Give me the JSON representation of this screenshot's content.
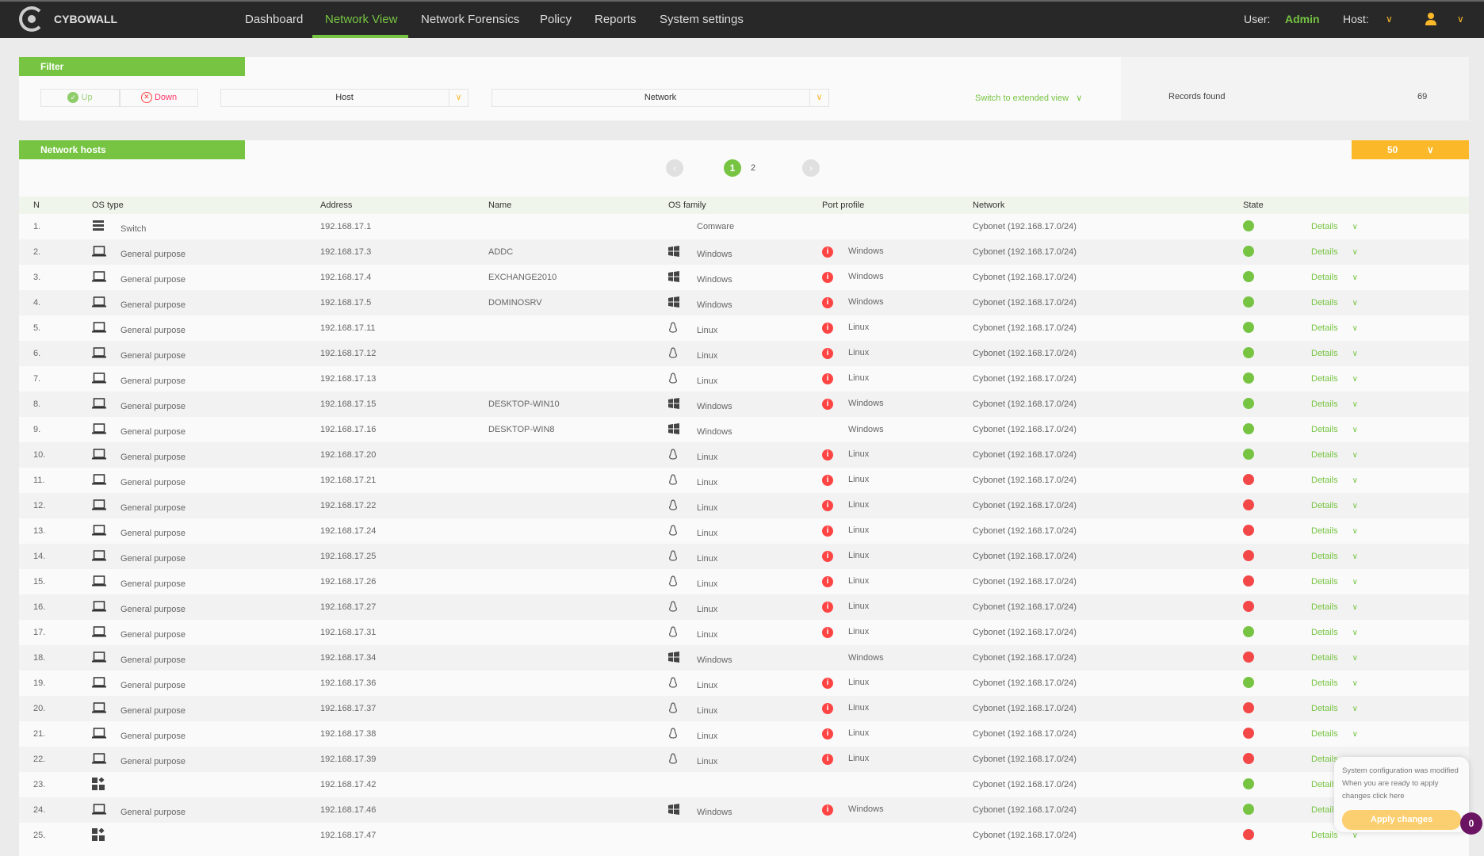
{
  "nav": {
    "brand": "CYBOWALL",
    "items": [
      "Dashboard",
      "Network View",
      "Network Forensics",
      "Policy",
      "Reports",
      "System settings"
    ],
    "active": "Network View",
    "user_label": "User:",
    "user": "Admin",
    "host_label": "Host:"
  },
  "filter": {
    "title": "Filter",
    "up": "Up",
    "down": "Down",
    "host": "Host",
    "network": "Network",
    "extended": "Switch to extended view",
    "records_label": "Records found",
    "records": "69"
  },
  "hosts": {
    "title": "Network hosts",
    "page_size": "50",
    "pages": [
      "1",
      "2"
    ],
    "current_page": "1",
    "columns": [
      "N",
      "OS type",
      "Address",
      "Name",
      "OS family",
      "Port profile",
      "Network",
      "State"
    ],
    "details_label": "Details",
    "rows": [
      [
        "1.",
        "switch",
        "Switch",
        "192.168.17.1",
        "",
        "",
        "Comware",
        "",
        "",
        "Cybonet (192.168.17.0/24)",
        "up"
      ],
      [
        "2.",
        "laptop",
        "General purpose",
        "192.168.17.3",
        "ADDC",
        "windows",
        "Windows",
        "info",
        "Windows",
        "Cybonet (192.168.17.0/24)",
        "up"
      ],
      [
        "3.",
        "laptop",
        "General purpose",
        "192.168.17.4",
        "EXCHANGE2010",
        "windows",
        "Windows",
        "info",
        "Windows",
        "Cybonet (192.168.17.0/24)",
        "up"
      ],
      [
        "4.",
        "laptop",
        "General purpose",
        "192.168.17.5",
        "DOMINOSRV",
        "windows",
        "Windows",
        "info",
        "Windows",
        "Cybonet (192.168.17.0/24)",
        "up"
      ],
      [
        "5.",
        "laptop",
        "General purpose",
        "192.168.17.11",
        "",
        "linux",
        "Linux",
        "info",
        "Linux",
        "Cybonet (192.168.17.0/24)",
        "up"
      ],
      [
        "6.",
        "laptop",
        "General purpose",
        "192.168.17.12",
        "",
        "linux",
        "Linux",
        "info",
        "Linux",
        "Cybonet (192.168.17.0/24)",
        "up"
      ],
      [
        "7.",
        "laptop",
        "General purpose",
        "192.168.17.13",
        "",
        "linux",
        "Linux",
        "info",
        "Linux",
        "Cybonet (192.168.17.0/24)",
        "up"
      ],
      [
        "8.",
        "laptop",
        "General purpose",
        "192.168.17.15",
        "DESKTOP-WIN10",
        "windows",
        "Windows",
        "info",
        "Windows",
        "Cybonet (192.168.17.0/24)",
        "up"
      ],
      [
        "9.",
        "laptop",
        "General purpose",
        "192.168.17.16",
        "DESKTOP-WIN8",
        "windows",
        "Windows",
        "",
        "Windows",
        "Cybonet (192.168.17.0/24)",
        "up"
      ],
      [
        "10.",
        "laptop",
        "General purpose",
        "192.168.17.20",
        "",
        "linux",
        "Linux",
        "info",
        "Linux",
        "Cybonet (192.168.17.0/24)",
        "up"
      ],
      [
        "11.",
        "laptop",
        "General purpose",
        "192.168.17.21",
        "",
        "linux",
        "Linux",
        "info",
        "Linux",
        "Cybonet (192.168.17.0/24)",
        "down"
      ],
      [
        "12.",
        "laptop",
        "General purpose",
        "192.168.17.22",
        "",
        "linux",
        "Linux",
        "info",
        "Linux",
        "Cybonet (192.168.17.0/24)",
        "down"
      ],
      [
        "13.",
        "laptop",
        "General purpose",
        "192.168.17.24",
        "",
        "linux",
        "Linux",
        "info",
        "Linux",
        "Cybonet (192.168.17.0/24)",
        "down"
      ],
      [
        "14.",
        "laptop",
        "General purpose",
        "192.168.17.25",
        "",
        "linux",
        "Linux",
        "info",
        "Linux",
        "Cybonet (192.168.17.0/24)",
        "down"
      ],
      [
        "15.",
        "laptop",
        "General purpose",
        "192.168.17.26",
        "",
        "linux",
        "Linux",
        "info",
        "Linux",
        "Cybonet (192.168.17.0/24)",
        "down"
      ],
      [
        "16.",
        "laptop",
        "General purpose",
        "192.168.17.27",
        "",
        "linux",
        "Linux",
        "info",
        "Linux",
        "Cybonet (192.168.17.0/24)",
        "down"
      ],
      [
        "17.",
        "laptop",
        "General purpose",
        "192.168.17.31",
        "",
        "linux",
        "Linux",
        "info",
        "Linux",
        "Cybonet (192.168.17.0/24)",
        "up"
      ],
      [
        "18.",
        "laptop",
        "General purpose",
        "192.168.17.34",
        "",
        "windows",
        "Windows",
        "",
        "Windows",
        "Cybonet (192.168.17.0/24)",
        "down"
      ],
      [
        "19.",
        "laptop",
        "General purpose",
        "192.168.17.36",
        "",
        "linux",
        "Linux",
        "info",
        "Linux",
        "Cybonet (192.168.17.0/24)",
        "up"
      ],
      [
        "20.",
        "laptop",
        "General purpose",
        "192.168.17.37",
        "",
        "linux",
        "Linux",
        "info",
        "Linux",
        "Cybonet (192.168.17.0/24)",
        "down"
      ],
      [
        "21.",
        "laptop",
        "General purpose",
        "192.168.17.38",
        "",
        "linux",
        "Linux",
        "info",
        "Linux",
        "Cybonet (192.168.17.0/24)",
        "down"
      ],
      [
        "22.",
        "laptop",
        "General purpose",
        "192.168.17.39",
        "",
        "linux",
        "Linux",
        "info",
        "Linux",
        "Cybonet (192.168.17.0/24)",
        "down"
      ],
      [
        "23.",
        "apps",
        "",
        "192.168.17.42",
        "",
        "",
        "",
        "",
        "",
        "Cybonet (192.168.17.0/24)",
        "up"
      ],
      [
        "24.",
        "laptop",
        "General purpose",
        "192.168.17.46",
        "",
        "windows",
        "Windows",
        "info",
        "Windows",
        "Cybonet (192.168.17.0/24)",
        "up"
      ],
      [
        "25.",
        "apps",
        "",
        "192.168.17.47",
        "",
        "",
        "",
        "",
        "",
        "Cybonet (192.168.17.0/24)",
        "down"
      ]
    ]
  },
  "popup": {
    "line1": "System configuration was modified",
    "line2": "When you are ready to apply",
    "line3": "changes click here",
    "button": "Apply changes",
    "badge": "0"
  },
  "colors": {
    "green": "#76c442",
    "orange": "#fbb829",
    "red": "#f44848",
    "dark": "#282828",
    "purple": "#6a1462"
  }
}
